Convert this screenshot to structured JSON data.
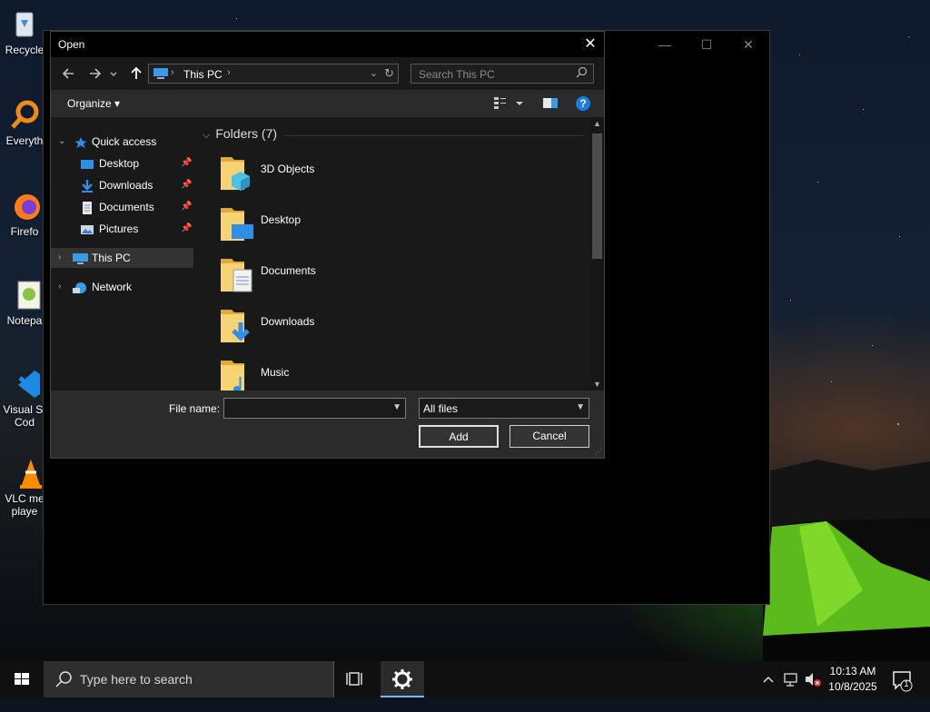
{
  "desktop": {
    "icons": [
      {
        "name": "recycle-bin",
        "label": "Recycle"
      },
      {
        "name": "everything",
        "label": "Everyth"
      },
      {
        "name": "firefox",
        "label": "Firefo"
      },
      {
        "name": "notepad",
        "label": "Notepa"
      },
      {
        "name": "vscode",
        "label": "Visual St",
        "label2": "Cod"
      },
      {
        "name": "vlc",
        "label": "VLC me",
        "label2": "playe"
      }
    ]
  },
  "dialog": {
    "title": "Open",
    "close_glyph": "✕",
    "address": {
      "location": "This PC"
    },
    "search": {
      "placeholder": "Search This PC"
    },
    "toolbar": {
      "organize_label": "Organize ▾",
      "help_glyph": "?"
    },
    "nav": {
      "quick_access": "Quick access",
      "items": [
        {
          "label": "Desktop",
          "pinned": true
        },
        {
          "label": "Downloads",
          "pinned": true
        },
        {
          "label": "Documents",
          "pinned": true
        },
        {
          "label": "Pictures",
          "pinned": true
        }
      ],
      "this_pc": "This PC",
      "network": "Network"
    },
    "content": {
      "group_header": "Folders (7)",
      "folders": [
        {
          "label": "3D Objects",
          "icon": "3d-objects"
        },
        {
          "label": "Desktop",
          "icon": "desktop"
        },
        {
          "label": "Documents",
          "icon": "documents"
        },
        {
          "label": "Downloads",
          "icon": "downloads"
        },
        {
          "label": "Music",
          "icon": "music"
        }
      ]
    },
    "file_name_label": "File name:",
    "file_name_value": "",
    "file_type_selected": "All files",
    "add_button": "Add",
    "cancel_button": "Cancel"
  },
  "background_window": {
    "controls": {
      "minimize": "—",
      "maximize": "☐",
      "close": "✕"
    }
  },
  "taskbar": {
    "search_placeholder": "Type here to search",
    "clock_time": "10:13 AM",
    "clock_date": "10/8/2025",
    "notification_count": "1"
  },
  "colors": {
    "accent": "#1a7be0",
    "folder": "#f0c75a",
    "taskbar_active": "#76b9ed"
  }
}
